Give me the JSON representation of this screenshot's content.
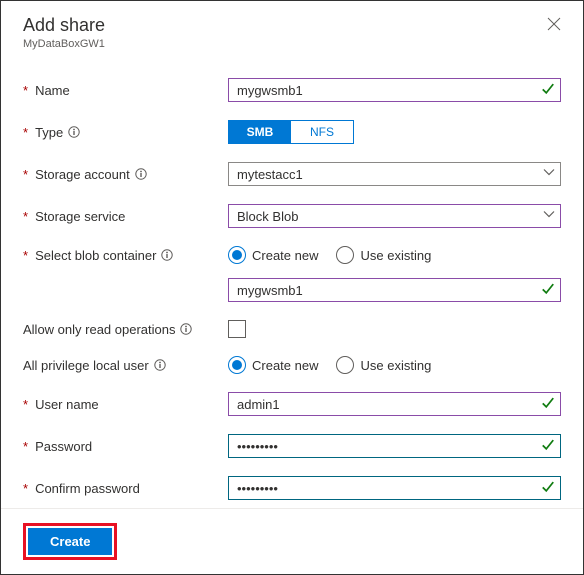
{
  "header": {
    "title": "Add share",
    "subtitle": "MyDataBoxGW1"
  },
  "labels": {
    "name": "Name",
    "type": "Type",
    "storage_account": "Storage account",
    "storage_service": "Storage service",
    "select_blob_container": "Select blob container",
    "allow_read_only": "Allow only read operations",
    "all_privilege_user": "All privilege local user",
    "user_name": "User name",
    "password": "Password",
    "confirm_password": "Confirm password"
  },
  "values": {
    "name": "mygwsmb1",
    "storage_account": "mytestacc1",
    "storage_service": "Block Blob",
    "container_name": "mygwsmb1",
    "user_name": "admin1",
    "password": "•••••••••",
    "confirm_password": "•••••••••"
  },
  "type_toggle": {
    "smb": "SMB",
    "nfs": "NFS",
    "selected": "SMB"
  },
  "radio_options": {
    "create_new": "Create new",
    "use_existing": "Use existing"
  },
  "footer": {
    "create": "Create"
  }
}
